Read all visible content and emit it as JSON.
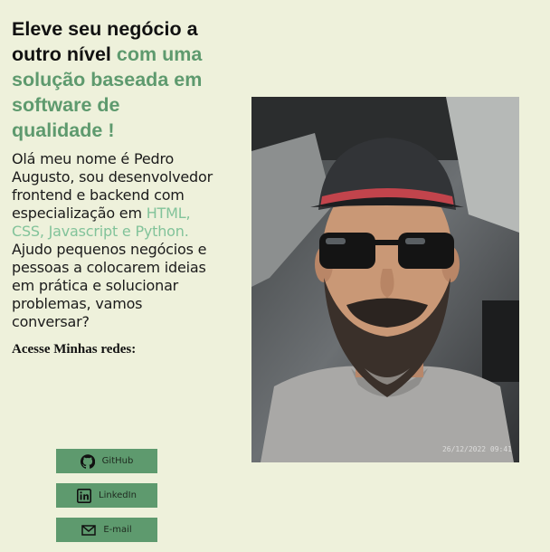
{
  "hero": {
    "headline_dark": "Eleve seu negócio a outro nível",
    "headline_accent": "com uma solução baseada em software de qualidade !",
    "bio_before": "Olá meu nome é Pedro Augusto, sou desenvolvedor frontend e backend com especialização em",
    "bio_accent": "HTML, CSS, Javascript e Python.",
    "bio_after": "Ajudo pequenos negócios e pessoas a colocarem ideias em prática e solucionar problemas, vamos conversar?",
    "social_title": "Acesse Minhas redes:"
  },
  "social": {
    "buttons": [
      {
        "label": "GitHub",
        "icon": "github-icon"
      },
      {
        "label": "LinkedIn",
        "icon": "linkedin-icon"
      },
      {
        "label": "E-mail",
        "icon": "mail-icon"
      }
    ]
  },
  "photo": {
    "timestamp": "26/12/2022 09:41"
  },
  "colors": {
    "background": "#eef1db",
    "accent": "#5e9a6e",
    "accent_light": "#82c39a"
  }
}
